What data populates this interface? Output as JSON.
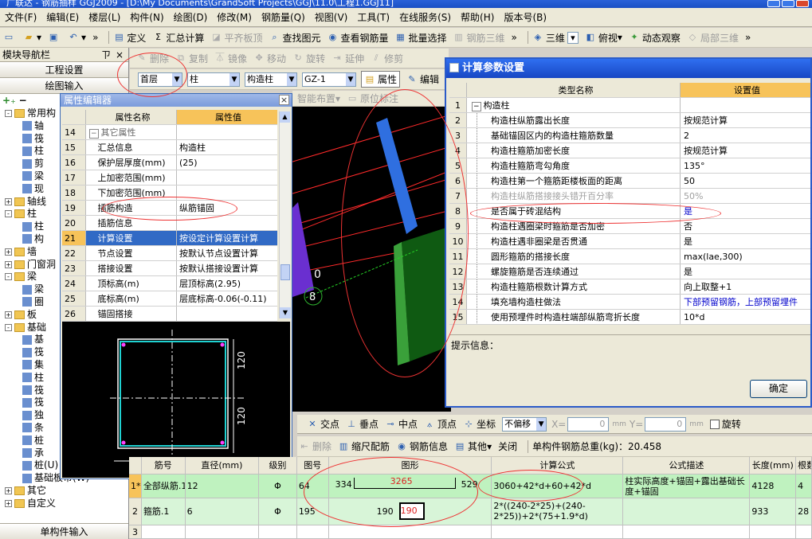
{
  "title_bar": "广联达 - 钢筋抽样 GGJ2009 - [D:\\My Documents\\GrandSoft Projects\\GGJ\\11.0\\工程1.GGJ11]",
  "menu": [
    "文件(F)",
    "编辑(E)",
    "楼层(L)",
    "构件(N)",
    "绘图(D)",
    "修改(M)",
    "钢筋量(Q)",
    "视图(V)",
    "工具(T)",
    "在线服务(S)",
    "帮助(H)",
    "版本号(B)"
  ],
  "toolbar1": {
    "define": "定义",
    "sum": "汇总计算",
    "flat_slab": "平齐板顶",
    "find": "查找图元",
    "view_rebar": "查看钢筋量",
    "batch": "批量选择",
    "rebar3d": "钢筋三维",
    "view3d": "三维",
    "top_view": "俯视",
    "dynamic": "动态观察",
    "local3d": "局部三维"
  },
  "toolbar2": {
    "delete": "删除",
    "copy": "复制",
    "mirror": "镜像",
    "move": "移动",
    "rotate": "旋转",
    "extend": "延伸",
    "trim": "修剪"
  },
  "toolbar3": {
    "floor": "首层",
    "type": "柱",
    "subtype": "构造柱",
    "name": "GZ-1",
    "prop": "属性",
    "edit": "编辑"
  },
  "toolbar4": {
    "smart": "智能布置",
    "in_situ": "原位标注"
  },
  "leftnav": {
    "title": "模块导航栏",
    "pin": "ㄗ",
    "close": "×",
    "project_settings": "工程设置",
    "drawing_input": "绘图输入",
    "tree": [
      {
        "lv": 0,
        "pm": "-",
        "folder": true,
        "label": "常用构"
      },
      {
        "lv": 1,
        "label": "轴"
      },
      {
        "lv": 1,
        "label": "筏"
      },
      {
        "lv": 1,
        "label": "柱"
      },
      {
        "lv": 1,
        "label": "剪"
      },
      {
        "lv": 1,
        "label": "梁"
      },
      {
        "lv": 1,
        "label": "现"
      },
      {
        "lv": 0,
        "pm": "+",
        "folder": true,
        "label": "轴线"
      },
      {
        "lv": 0,
        "pm": "-",
        "folder": true,
        "label": "柱"
      },
      {
        "lv": 1,
        "label": "柱"
      },
      {
        "lv": 1,
        "label": "构"
      },
      {
        "lv": 0,
        "pm": "+",
        "folder": true,
        "label": "墙"
      },
      {
        "lv": 0,
        "pm": "+",
        "folder": true,
        "label": "门窗洞"
      },
      {
        "lv": 0,
        "pm": "-",
        "folder": true,
        "label": "梁"
      },
      {
        "lv": 1,
        "label": "梁"
      },
      {
        "lv": 1,
        "label": "圈"
      },
      {
        "lv": 0,
        "pm": "+",
        "folder": true,
        "label": "板"
      },
      {
        "lv": 0,
        "pm": "-",
        "folder": true,
        "label": "基础"
      },
      {
        "lv": 1,
        "label": "基"
      },
      {
        "lv": 1,
        "label": "筏"
      },
      {
        "lv": 1,
        "label": "集"
      },
      {
        "lv": 1,
        "label": "柱"
      },
      {
        "lv": 1,
        "label": "筏"
      },
      {
        "lv": 1,
        "label": "筏"
      },
      {
        "lv": 1,
        "label": "独"
      },
      {
        "lv": 1,
        "label": "条"
      },
      {
        "lv": 1,
        "label": "桩"
      },
      {
        "lv": 1,
        "label": "承"
      },
      {
        "lv": 1,
        "label": "桩(U)"
      },
      {
        "lv": 1,
        "label": "基础板带(W)"
      },
      {
        "lv": 0,
        "pm": "+",
        "folder": true,
        "label": "其它"
      },
      {
        "lv": 0,
        "pm": "+",
        "folder": true,
        "label": "自定义"
      }
    ],
    "single_input": "单构件输入"
  },
  "prop_editor": {
    "title": "属性编辑器",
    "close": "×",
    "headers": [
      "属性名称",
      "属性值"
    ],
    "rows": [
      {
        "n": "14",
        "k": "其它属性",
        "v": "",
        "grp": true
      },
      {
        "n": "15",
        "k": "汇总信息",
        "v": "构造柱"
      },
      {
        "n": "16",
        "k": "保护层厚度(mm)",
        "v": "(25)"
      },
      {
        "n": "17",
        "k": "上加密范围(mm)",
        "v": ""
      },
      {
        "n": "18",
        "k": "下加密范围(mm)",
        "v": ""
      },
      {
        "n": "19",
        "k": "插筋构造",
        "v": "纵筋锚固"
      },
      {
        "n": "20",
        "k": "插筋信息",
        "v": ""
      },
      {
        "n": "21",
        "k": "计算设置",
        "v": "按设定计算设置计算",
        "sel": true
      },
      {
        "n": "22",
        "k": "节点设置",
        "v": "按默认节点设置计算"
      },
      {
        "n": "23",
        "k": "搭接设置",
        "v": "按默认搭接设置计算"
      },
      {
        "n": "24",
        "k": "顶标高(m)",
        "v": "层顶标高(2.95)"
      },
      {
        "n": "25",
        "k": "底标高(m)",
        "v": "层底标高-0.06(-0.11)"
      },
      {
        "n": "26",
        "k": "锚固搭接",
        "v": ""
      }
    ],
    "dim_120": "120",
    "dim_120b": "120"
  },
  "calc_dialog": {
    "title": "计算参数设置",
    "headers": [
      "类型名称",
      "设置值"
    ],
    "rows": [
      {
        "n": "1",
        "k": "构造柱",
        "v": "",
        "grp": true
      },
      {
        "n": "2",
        "k": "构造柱纵筋露出长度",
        "v": "按规范计算"
      },
      {
        "n": "3",
        "k": "基础锚固区内的构造柱箍筋数量",
        "v": "2"
      },
      {
        "n": "4",
        "k": "构造柱箍筋加密长度",
        "v": "按规范计算"
      },
      {
        "n": "5",
        "k": "构造柱箍筋弯勾角度",
        "v": "135°"
      },
      {
        "n": "6",
        "k": "构造柱第一个箍筋距楼板面的距离",
        "v": "50"
      },
      {
        "n": "7",
        "k": "构造柱纵筋搭接接头错开百分率",
        "v": "50%",
        "dim": true
      },
      {
        "n": "8",
        "k": "是否属于砖混结构",
        "v": "是",
        "blue": true
      },
      {
        "n": "9",
        "k": "构造柱遇圈梁时箍筋是否加密",
        "v": "否"
      },
      {
        "n": "10",
        "k": "构造柱遇非圈梁是否贯通",
        "v": "是"
      },
      {
        "n": "11",
        "k": "圆形箍筋的搭接长度",
        "v": "max(lae,300)"
      },
      {
        "n": "12",
        "k": "螺旋箍筋是否连续通过",
        "v": "是"
      },
      {
        "n": "13",
        "k": "构造柱箍筋根数计算方式",
        "v": "向上取整+1"
      },
      {
        "n": "14",
        "k": "填充墙构造柱做法",
        "v": "下部预留钢筋，上部预留埋件",
        "blue": true
      },
      {
        "n": "15",
        "k": "使用预埋件时构造柱端部纵筋弯折长度",
        "v": "10*d"
      }
    ],
    "hint_label": "提示信息：",
    "ok": "确定"
  },
  "snap_bar": {
    "intersection": "交点",
    "perpendicular": "垂点",
    "midpoint": "中点",
    "vertex": "顶点",
    "coordinate": "坐标",
    "offset": "不偏移",
    "x_label": "X=",
    "x_val": "0",
    "y_label": "Y=",
    "y_val": "0",
    "mm": "mm",
    "rotate": "旋转"
  },
  "rebar_bar": {
    "delete": "删除",
    "scale": "缩尺配筋",
    "info": "钢筋信息",
    "other": "其他",
    "close": "关闭",
    "total": "单构件钢筋总重(kg)：20.458"
  },
  "grid": {
    "headers": [
      "筋号",
      "直径(mm)",
      "级别",
      "图号",
      "图形",
      "计算公式",
      "公式描述",
      "长度(mm)",
      "根数"
    ],
    "rows": [
      {
        "n": "1*",
        "name": "全部纵筋.1",
        "dia": "12",
        "lvl": "Φ",
        "fig": "64",
        "l": "334",
        "mid": "3265",
        "r": "529",
        "formula": "3060+42*d+60+42*d",
        "desc": "柱实际高度+锚固+露出基础长度+锚固",
        "len": "4128",
        "cnt": "4"
      },
      {
        "n": "2",
        "name": "箍筋.1",
        "dia": "6",
        "lvl": "Φ",
        "fig": "195",
        "l": "190",
        "mid": "190",
        "r": "",
        "formula": "2*((240-2*25)+(240-2*25))+2*(75+1.9*d)",
        "desc": "",
        "len": "933",
        "cnt": "28"
      },
      {
        "n": "3",
        "name": "",
        "dia": "",
        "lvl": "",
        "fig": "",
        "l": "",
        "mid": "",
        "r": "",
        "formula": "",
        "desc": "",
        "len": "",
        "cnt": ""
      }
    ]
  },
  "viewport_labels": {
    "num0": "0",
    "num8": "8"
  },
  "colors": {
    "accent": "#316ac5",
    "header_orange": "#f7c35a",
    "annot_red": "#e33"
  }
}
